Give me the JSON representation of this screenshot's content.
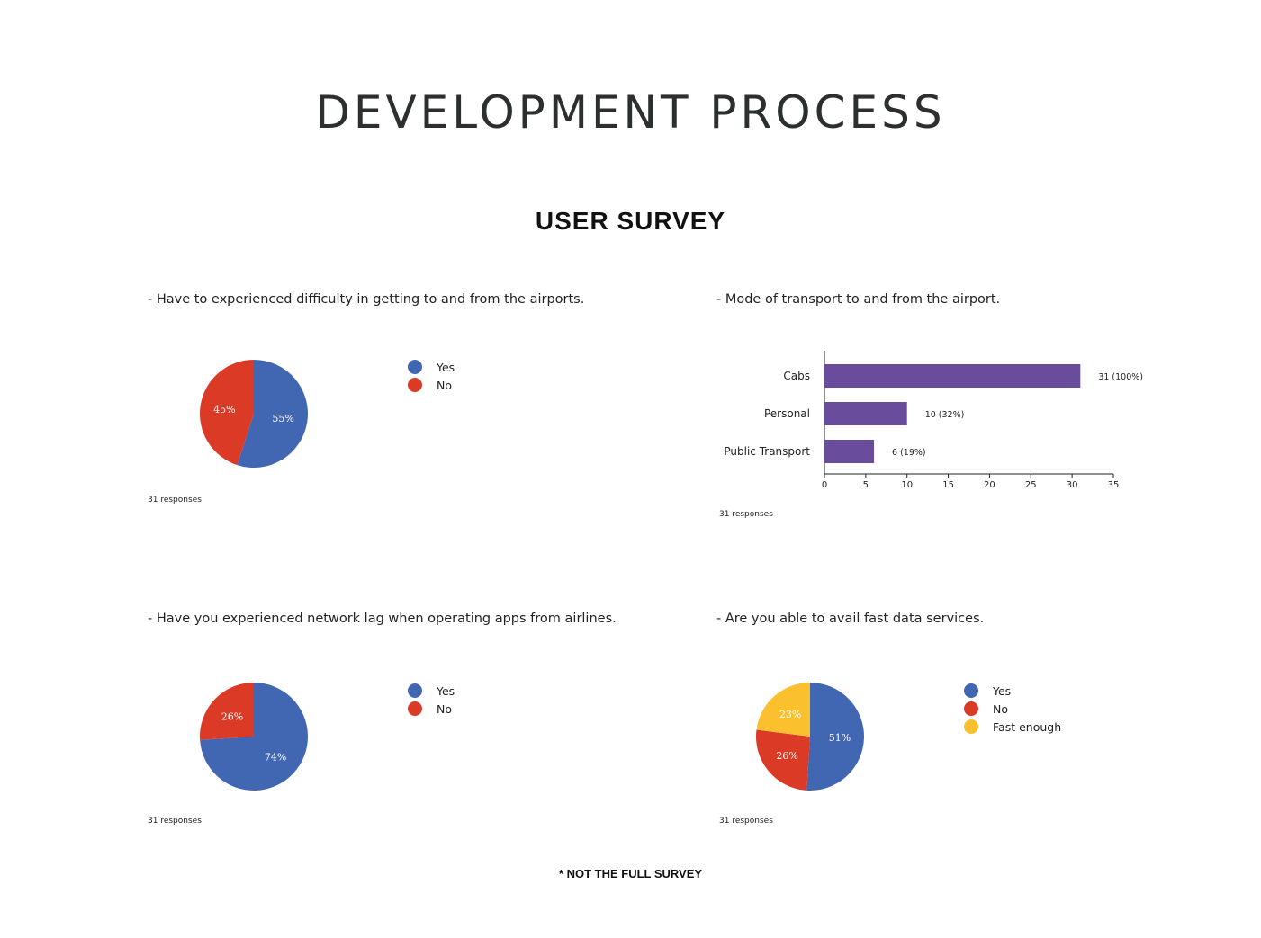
{
  "page": {
    "title": "DEVELOPMENT PROCESS",
    "section_title": "USER SURVEY",
    "footnote": "* NOT THE FULL SURVEY"
  },
  "colors": {
    "blue": "#4267b2",
    "red": "#db3b26",
    "yellow": "#fbc02d",
    "purple": "#6a4c9c"
  },
  "chart_data": [
    {
      "type": "pie",
      "question": "- Have to experienced difficulty in getting to and from the airports.",
      "responses": "31 responses",
      "slices": [
        {
          "label": "Yes",
          "value": 55,
          "pct_label": "55%",
          "color": "#4267b2"
        },
        {
          "label": "No",
          "value": 45,
          "pct_label": "45%",
          "color": "#db3b26"
        }
      ]
    },
    {
      "type": "bar",
      "orientation": "horizontal",
      "question": "- Mode of transport to and from the airport.",
      "responses": "31 responses",
      "categories": [
        "Cabs",
        "Personal",
        "Public Transport"
      ],
      "values": [
        31,
        10,
        6
      ],
      "data_labels": [
        "31 (100%)",
        "10 (32%)",
        "6 (19%)"
      ],
      "xlim": [
        0,
        35
      ],
      "xticks": [
        0,
        5,
        10,
        15,
        20,
        25,
        30,
        35
      ],
      "color": "#6a4c9c"
    },
    {
      "type": "pie",
      "question": "- Have you experienced network lag when operating apps from airlines.",
      "responses": "31 responses",
      "slices": [
        {
          "label": "Yes",
          "value": 74,
          "pct_label": "74%",
          "color": "#4267b2"
        },
        {
          "label": "No",
          "value": 26,
          "pct_label": "26%",
          "color": "#db3b26"
        }
      ]
    },
    {
      "type": "pie",
      "question": "- Are you able to avail fast data services.",
      "responses": "31 responses",
      "slices": [
        {
          "label": "Yes",
          "value": 51,
          "pct_label": "51%",
          "color": "#4267b2"
        },
        {
          "label": "No",
          "value": 26,
          "pct_label": "26%",
          "color": "#db3b26"
        },
        {
          "label": "Fast enough",
          "value": 23,
          "pct_label": "23%",
          "color": "#fbc02d"
        }
      ]
    }
  ]
}
